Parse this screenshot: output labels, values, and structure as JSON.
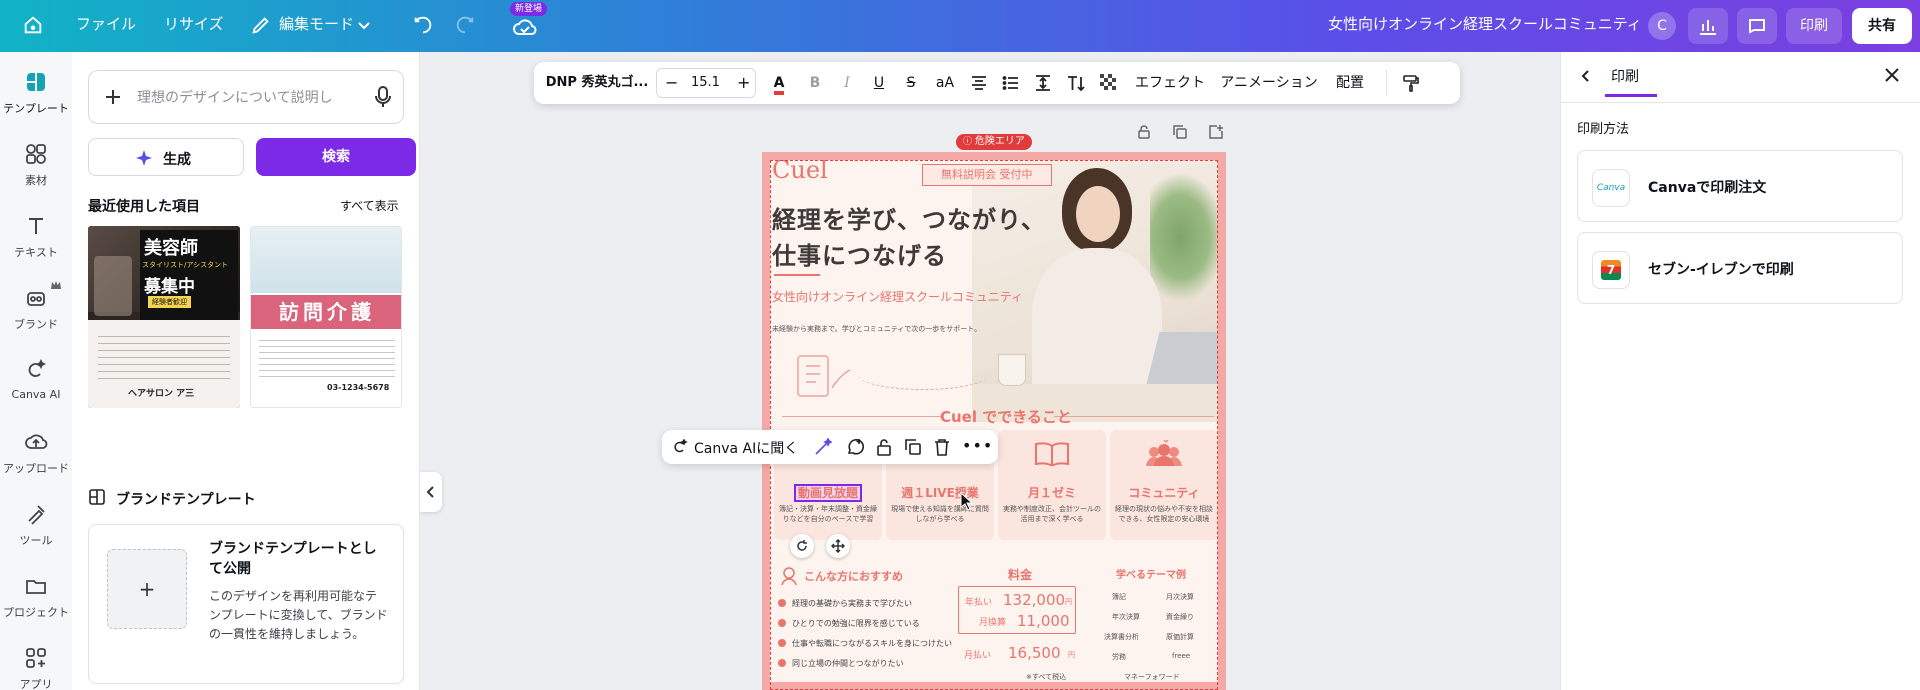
{
  "topbar": {
    "file": "ファイル",
    "resize": "リサイズ",
    "edit_mode": "編集モード",
    "new_badge": "新登場",
    "doc_title": "女性向けオンライン経理スクールコミュニティ",
    "avatar": "C",
    "print": "印刷",
    "share": "共有"
  },
  "rail": {
    "items": [
      {
        "label": "テンプレート",
        "icon": "template-icon"
      },
      {
        "label": "素材",
        "icon": "elements-icon"
      },
      {
        "label": "テキスト",
        "icon": "text-icon"
      },
      {
        "label": "ブランド",
        "icon": "brand-icon"
      },
      {
        "label": "Canva AI",
        "icon": "canva-ai-icon"
      },
      {
        "label": "アップロード",
        "icon": "upload-icon"
      },
      {
        "label": "ツール",
        "icon": "tools-icon"
      },
      {
        "label": "プロジェクト",
        "icon": "projects-icon"
      },
      {
        "label": "アプリ",
        "icon": "apps-icon"
      }
    ]
  },
  "panel": {
    "prompt_placeholder": "理想のデザインについて説明し",
    "generate": "生成",
    "search": "検索",
    "recent_heading": "最近使用した項目",
    "show_all": "すべて表示",
    "recent": [
      {
        "title": "美容師",
        "subtitle": "スタイリスト/アシスタント",
        "line": "募集中",
        "tag": "経験者歓迎",
        "salon": "ヘアサロン ア三"
      },
      {
        "title": "訪問介護",
        "phone": "03-1234-5678"
      }
    ],
    "brand_templates_heading": "ブランドテンプレート",
    "brand_card_title": "ブランドテンプレートとして公開",
    "brand_card_desc": "このデザインを再利用可能なテンプレートに変換して、ブランドの一貫性を維持しましょう。"
  },
  "format_toolbar": {
    "font": "DNP 秀英丸ゴ...",
    "size": "15.1",
    "effects": "エフェクト",
    "animation": "アニメーション",
    "arrange": "配置"
  },
  "canvas": {
    "danger_zone": "危険エリア",
    "ai_toolbar_label": "Canva AIに聞く"
  },
  "poster": {
    "brand": "Cuel",
    "badge": "無料説明会 受付中",
    "headline_1": "経理を学び、つながり、",
    "headline_2": "仕事につなげる",
    "subhead": "女性向けオンライン経理スクールコミュニティ",
    "tagline": "未経験から実務まで。学びとコミュニティで次の一歩をサポート。",
    "section": "Cuel でできること",
    "features": [
      {
        "title": "動画見放題",
        "desc": "簿記・決算・年末調整・資金繰りなどを自分のペースで学習"
      },
      {
        "title": "週１LIVE授業",
        "desc": "現場で使える知識を講師に質問しながら学べる"
      },
      {
        "title": "月１ゼミ",
        "desc": "実務や制度改正、会計ツールの活用まで深く学べる"
      },
      {
        "title": "コミュニティ",
        "desc": "経理の現状の悩みや不安を相談できる、女性限定の安心環境"
      }
    ],
    "recommend_heading": "こんな方におすすめ",
    "recommend": [
      "経理の基礎から実務まで学びたい",
      "ひとりでの勉強に限界を感じている",
      "仕事や転職につながるスキルを身につけたい",
      "同じ立場の仲間とつながりたい"
    ],
    "price_heading": "料金",
    "price_annual_label": "年払い",
    "price_annual": "132,000",
    "price_monthly_eq_label": "月換算",
    "price_monthly_eq": "11,000",
    "price_monthly_label": "月払い",
    "price_monthly": "16,500",
    "yen": "円",
    "tax_note": "※すべて税込",
    "themes_heading": "学べるテーマ例",
    "themes": [
      "簿記",
      "月次決算",
      "年次決算",
      "資金繰り",
      "決算書分析",
      "原価計算",
      "労務",
      "freee",
      "マネーフォワード"
    ]
  },
  "right_panel": {
    "title": "印刷",
    "section": "印刷方法",
    "options": [
      {
        "label": "Canvaで印刷注文",
        "logo": "Canva"
      },
      {
        "label": "セブン-イレブンで印刷",
        "logo": "7"
      }
    ]
  },
  "colors": {
    "accent_purple": "#7d2ae8",
    "poster_pink": "#e9756d",
    "danger_red": "#e23b3b"
  }
}
